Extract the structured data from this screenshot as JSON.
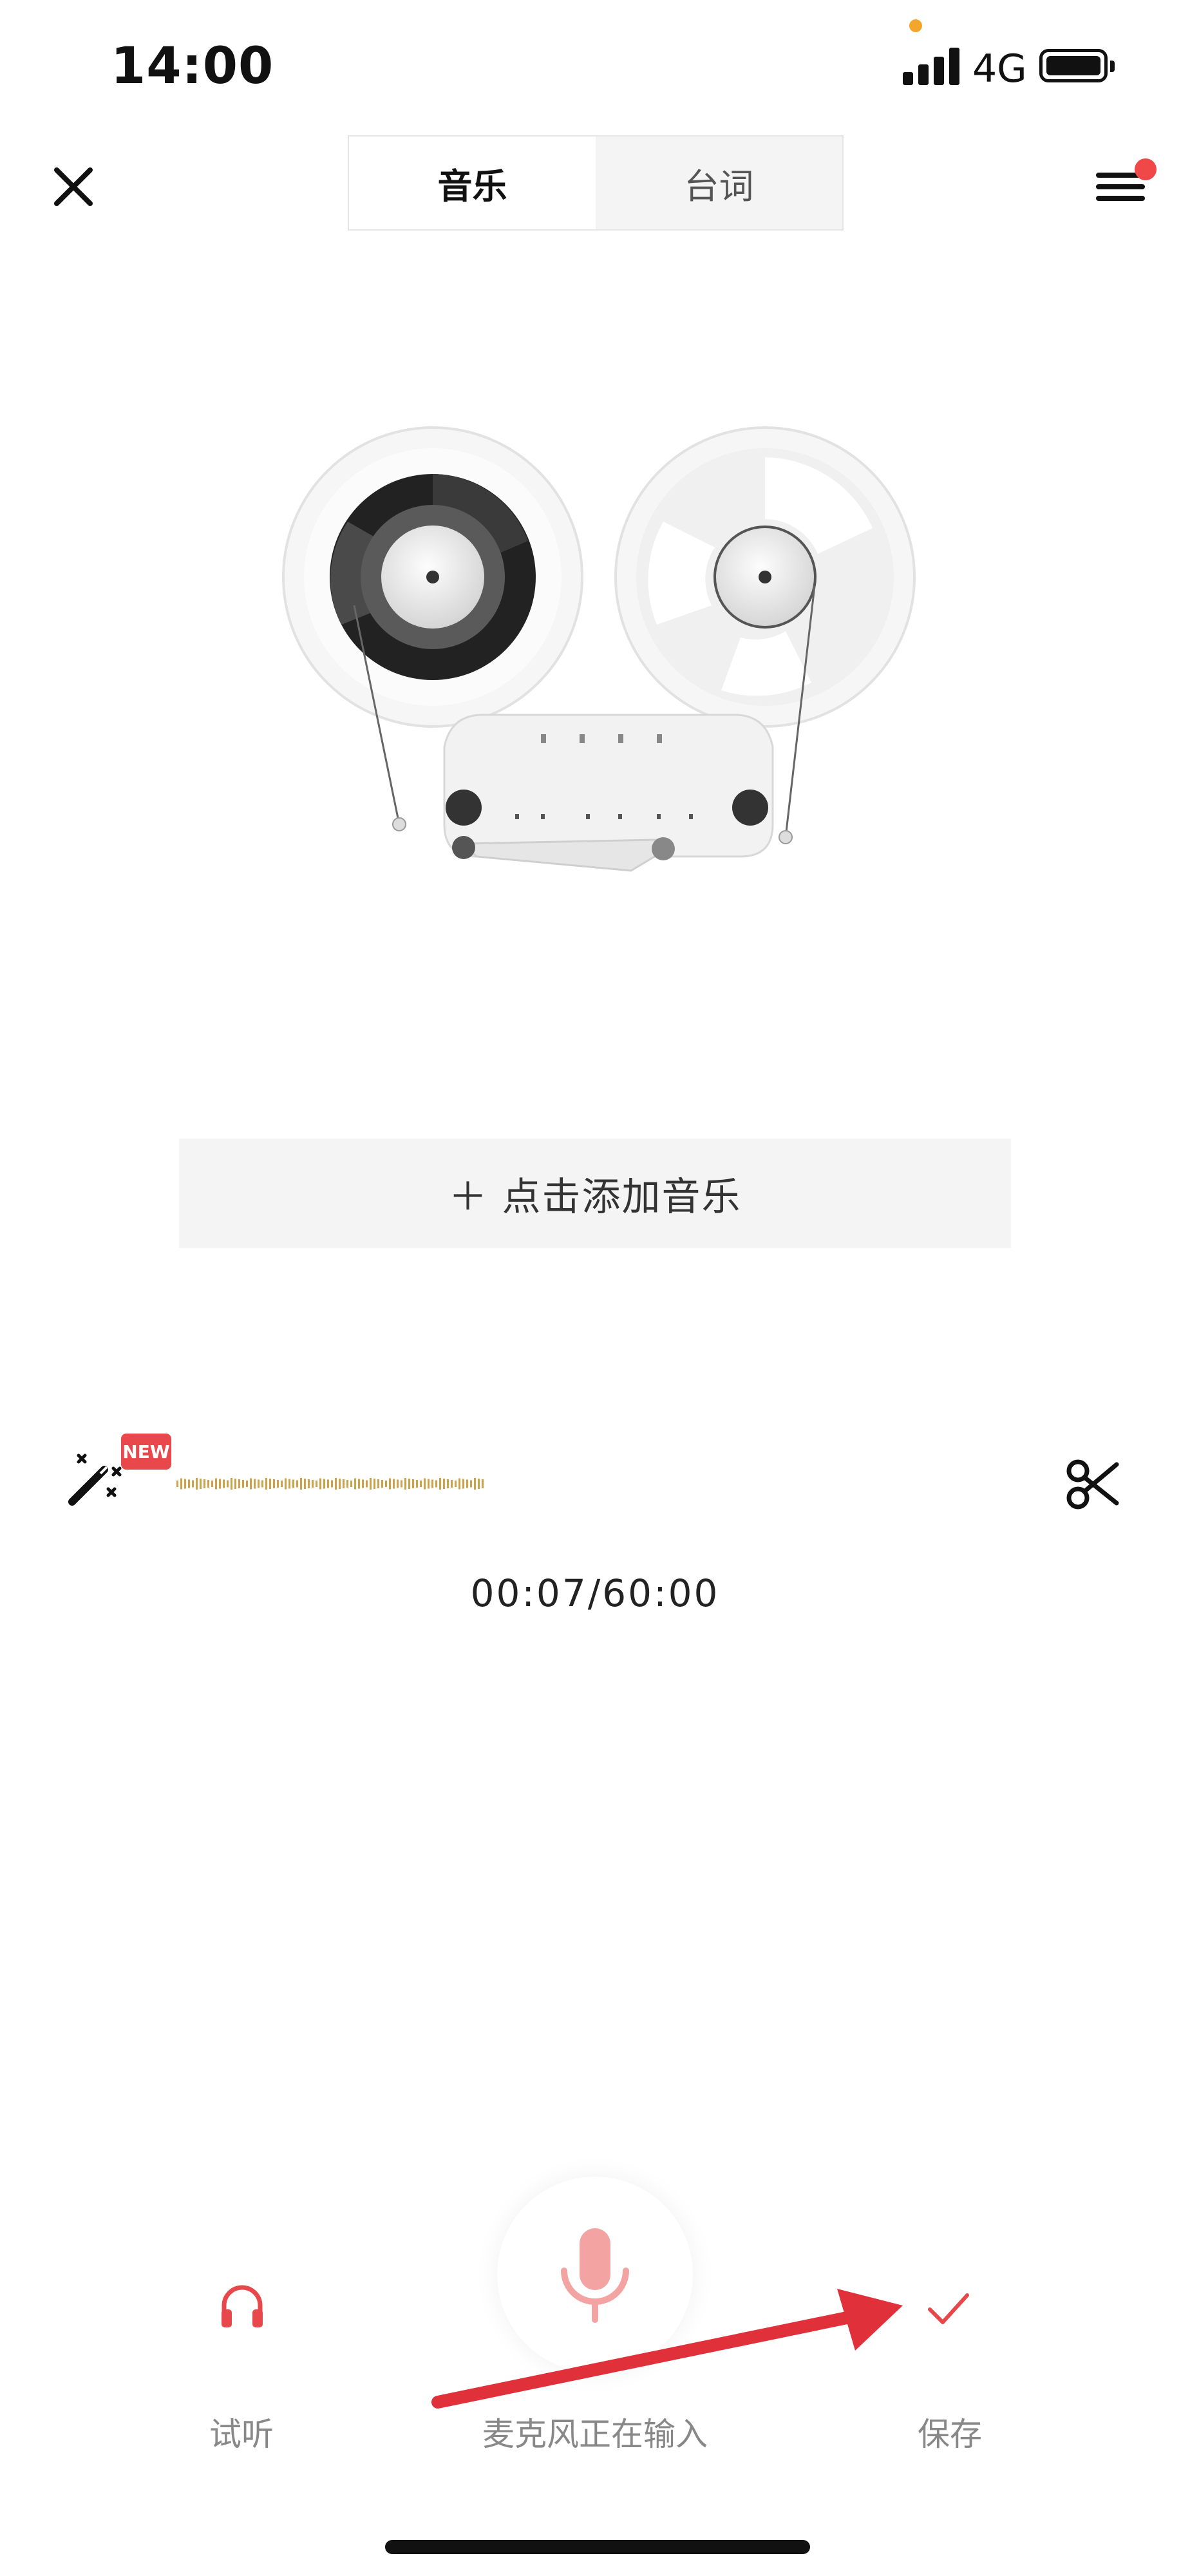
{
  "status_bar": {
    "time": "14:00",
    "network": "4G"
  },
  "nav": {
    "tabs": [
      {
        "label": "音乐",
        "active": true
      },
      {
        "label": "台词",
        "active": false
      }
    ],
    "icons": {
      "close": "close-icon",
      "menu": "menu-icon"
    }
  },
  "add_music": {
    "label": "＋ 点击添加音乐"
  },
  "recorder": {
    "new_badge": "NEW",
    "time": "00:07/60:00",
    "icons": {
      "magic": "magic-wand-icon",
      "trim": "scissors-icon"
    }
  },
  "bottom": {
    "preview_label": "试听",
    "mic_label": "麦克风正在输入",
    "save_label": "保存",
    "icons": {
      "preview": "headphones-icon",
      "mic": "microphone-icon",
      "save": "check-icon"
    }
  },
  "colors": {
    "accent": "#e8484b",
    "notice_dot": "#f04848",
    "mic": "#f4a3a3",
    "wave": "#c9a24a"
  }
}
